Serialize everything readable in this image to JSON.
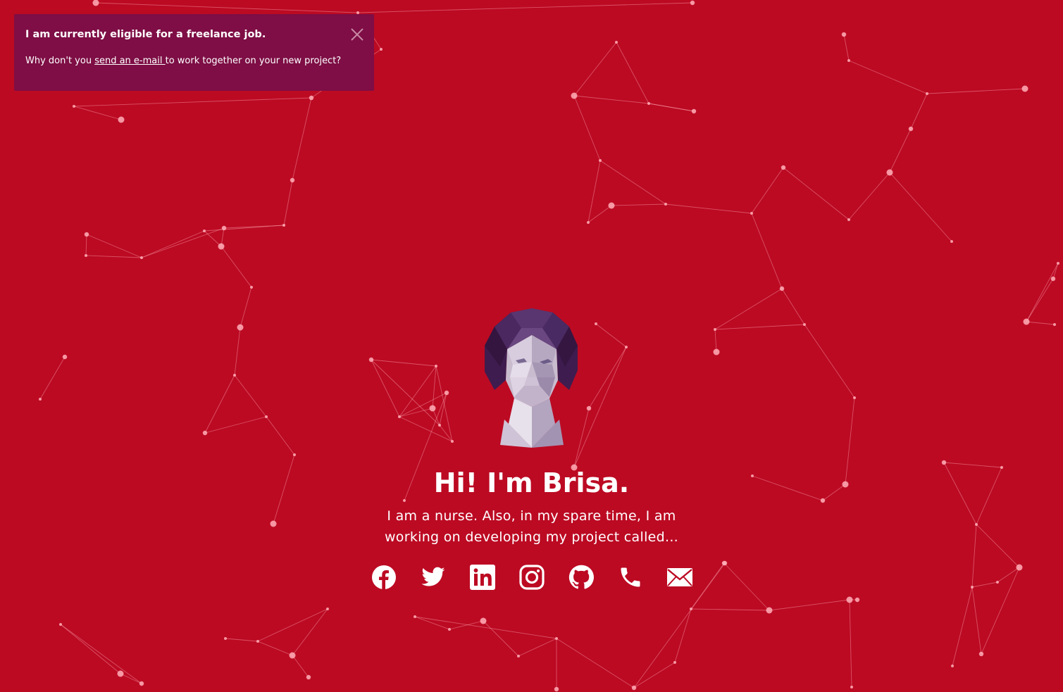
{
  "theme": {
    "background": "#bc0a23",
    "banner_background": "#7e0e45",
    "text": "#ffffff",
    "network_color": "#ffaab4"
  },
  "banner": {
    "title": "I am currently eligible for a freelance job.",
    "body_prefix": "Why don't you ",
    "link_text": "send an e-mail ",
    "body_suffix": "to work together on your new project?",
    "close_icon": "close-icon"
  },
  "hero": {
    "avatar_icon": "low-poly-portrait",
    "title": "Hi! I'm Brisa.",
    "subtitle": "I am a nurse. Also, in my spare time, I am working on developing my project called..."
  },
  "social": [
    {
      "name": "Facebook",
      "icon": "facebook-icon"
    },
    {
      "name": "Twitter",
      "icon": "twitter-icon"
    },
    {
      "name": "LinkedIn",
      "icon": "linkedin-icon"
    },
    {
      "name": "Instagram",
      "icon": "instagram-icon"
    },
    {
      "name": "GitHub",
      "icon": "github-icon"
    },
    {
      "name": "Phone",
      "icon": "phone-icon"
    },
    {
      "name": "E-mail",
      "icon": "envelope-icon"
    }
  ]
}
